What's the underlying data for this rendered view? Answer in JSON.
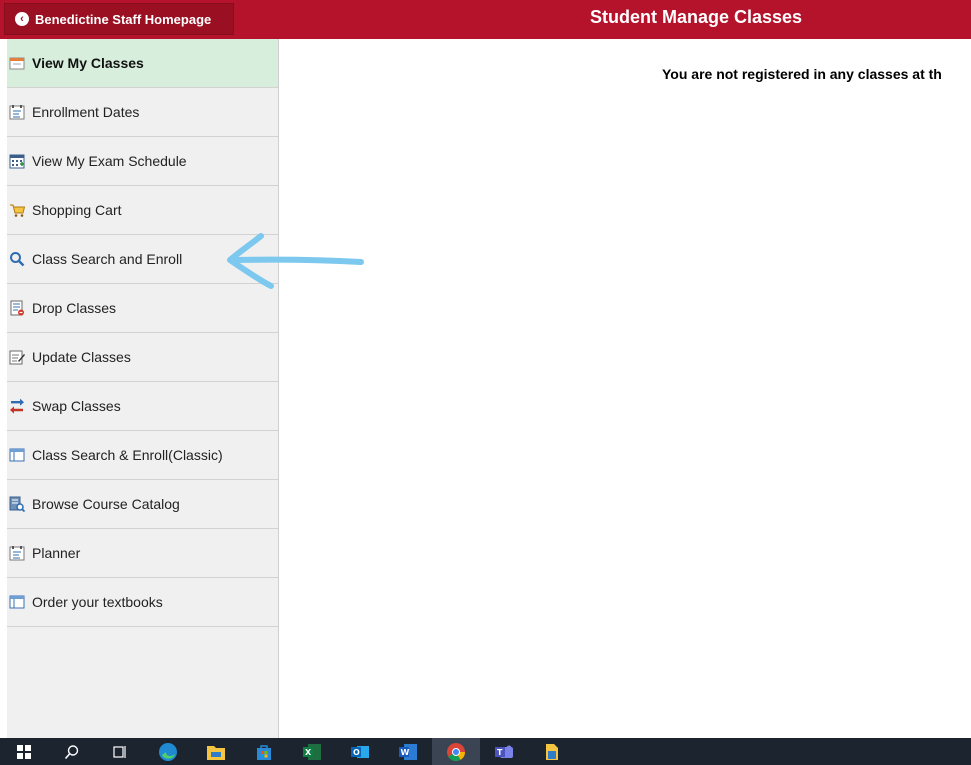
{
  "header": {
    "back_label": "Benedictine Staff Homepage",
    "title": "Student Manage Classes",
    "color": "#b5122b"
  },
  "sidebar": {
    "items": [
      {
        "label": "View My Classes",
        "icon": "calendar-icon",
        "selected": true
      },
      {
        "label": "Enrollment Dates",
        "icon": "schedule-list-icon"
      },
      {
        "label": "View My Exam Schedule",
        "icon": "exam-calendar-icon"
      },
      {
        "label": "Shopping Cart",
        "icon": "shopping-cart-icon"
      },
      {
        "label": "Class Search and Enroll",
        "icon": "search-icon"
      },
      {
        "label": "Drop Classes",
        "icon": "drop-classes-icon"
      },
      {
        "label": "Update Classes",
        "icon": "edit-document-icon"
      },
      {
        "label": "Swap Classes",
        "icon": "swap-arrows-icon"
      },
      {
        "label": "Class Search & Enroll(Classic)",
        "icon": "window-icon"
      },
      {
        "label": "Browse Course Catalog",
        "icon": "catalog-search-icon"
      },
      {
        "label": "Planner",
        "icon": "planner-icon"
      },
      {
        "label": "Order your textbooks",
        "icon": "window-icon"
      }
    ]
  },
  "main": {
    "empty_message": "You are not registered in any classes at th"
  },
  "annotation": {
    "icon": "hand-drawn-arrow-icon",
    "color": "#7cc8ee"
  },
  "taskbar": {
    "icons": [
      "windows-start-icon",
      "search-icon",
      "task-view-icon",
      "edge-icon",
      "file-explorer-icon",
      "store-icon",
      "excel-icon",
      "outlook-icon",
      "word-icon",
      "chrome-icon",
      "teams-icon",
      "file-icon"
    ]
  }
}
